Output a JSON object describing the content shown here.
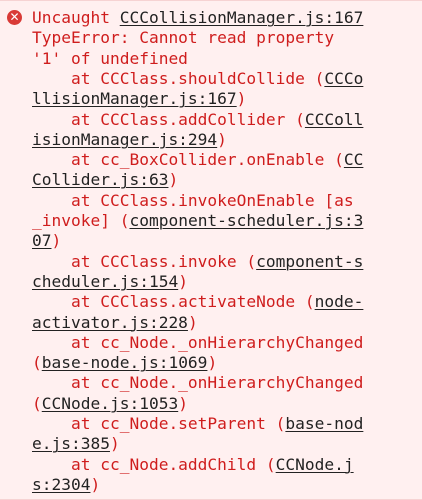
{
  "console_error": {
    "lines": [
      {
        "segments": [
          {
            "text": "Uncaught "
          },
          {
            "text": "CCCollisionManager.js:167",
            "link": true
          }
        ]
      },
      {
        "segments": [
          {
            "text": "TypeError: Cannot read property"
          }
        ]
      },
      {
        "segments": [
          {
            "text": "'1' of undefined"
          }
        ]
      },
      {
        "segments": [
          {
            "text": "    at CCClass.shouldCollide ("
          },
          {
            "text": "CCCo",
            "link": true
          }
        ]
      },
      {
        "segments": [
          {
            "text": "llisionManager.js:167",
            "link": true
          },
          {
            "text": ")"
          }
        ]
      },
      {
        "segments": [
          {
            "text": "    at CCClass.addCollider ("
          },
          {
            "text": "CCColl",
            "link": true
          }
        ]
      },
      {
        "segments": [
          {
            "text": "isionManager.js:294",
            "link": true
          },
          {
            "text": ")"
          }
        ]
      },
      {
        "segments": [
          {
            "text": "    at cc_BoxCollider.onEnable ("
          },
          {
            "text": "CC",
            "link": true
          }
        ]
      },
      {
        "segments": [
          {
            "text": "Collider.js:63",
            "link": true
          },
          {
            "text": ")"
          }
        ]
      },
      {
        "segments": [
          {
            "text": "    at CCClass.invokeOnEnable [as"
          }
        ]
      },
      {
        "segments": [
          {
            "text": "_invoke] ("
          },
          {
            "text": "component-scheduler.js:3",
            "link": true
          }
        ]
      },
      {
        "segments": [
          {
            "text": "07",
            "link": true
          },
          {
            "text": ")"
          }
        ]
      },
      {
        "segments": [
          {
            "text": "    at CCClass.invoke ("
          },
          {
            "text": "component-s",
            "link": true
          }
        ]
      },
      {
        "segments": [
          {
            "text": "cheduler.js:154",
            "link": true
          },
          {
            "text": ")"
          }
        ]
      },
      {
        "segments": [
          {
            "text": "    at CCClass.activateNode ("
          },
          {
            "text": "node-",
            "link": true
          }
        ]
      },
      {
        "segments": [
          {
            "text": "activator.js:228",
            "link": true
          },
          {
            "text": ")"
          }
        ]
      },
      {
        "segments": [
          {
            "text": "    at cc_Node._onHierarchyChanged"
          }
        ]
      },
      {
        "segments": [
          {
            "text": "("
          },
          {
            "text": "base-node.js:1069",
            "link": true
          },
          {
            "text": ")"
          }
        ]
      },
      {
        "segments": [
          {
            "text": "    at cc_Node._onHierarchyChanged"
          }
        ]
      },
      {
        "segments": [
          {
            "text": "("
          },
          {
            "text": "CCNode.js:1053",
            "link": true
          },
          {
            "text": ")"
          }
        ]
      },
      {
        "segments": [
          {
            "text": "    at cc_Node.setParent ("
          },
          {
            "text": "base-nod",
            "link": true
          }
        ]
      },
      {
        "segments": [
          {
            "text": "e.js:385",
            "link": true
          },
          {
            "text": ")"
          }
        ]
      },
      {
        "segments": [
          {
            "text": "    at cc_Node.addChild ("
          },
          {
            "text": "CCNode.j",
            "link": true
          }
        ]
      },
      {
        "segments": [
          {
            "text": "s:2304",
            "link": true
          },
          {
            "text": ")"
          }
        ]
      }
    ]
  },
  "icon": {
    "name": "error-circle-icon",
    "glyph": "✕"
  },
  "colors": {
    "background": "#fff0f0",
    "error_text": "#cf1d1d",
    "link_text": "#222222",
    "icon_bg": "#d93a36"
  }
}
